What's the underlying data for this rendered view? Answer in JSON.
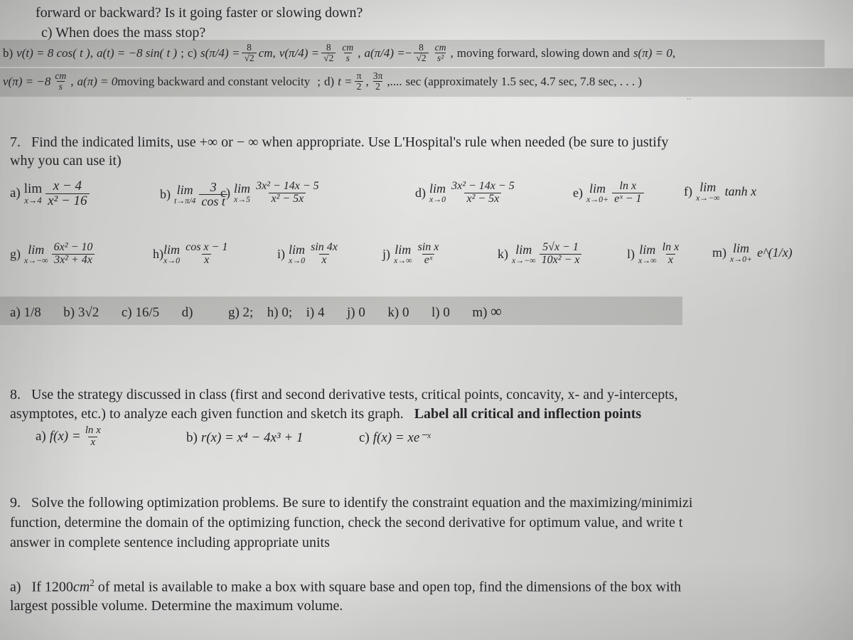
{
  "document": {
    "type": "calculus-worksheet-photo",
    "background_color": "#d2d2d0",
    "highlight_band_color": "#989896",
    "ink_color": "#26262a"
  },
  "top_fragment": {
    "line1": "forward or backward? Is it going faster or slowing down?",
    "line2": "c) When does the mass stop?",
    "answers_b": {
      "label": "b)",
      "v_of_t": "v(t) = 8 cos( t )",
      "a_of_t": "a(t) = −8 sin( t )",
      "sep1": ";",
      "label_c": "c)",
      "s_pi_4": "s(π/4) =",
      "s_value_num": "8",
      "s_value_den": "√2",
      "s_units": "cm",
      "v_pi_4": "v(π/4) =",
      "v_value_num": "8",
      "v_value_den": "√2",
      "v_units_num": "cm",
      "v_units_den": "s",
      "a_pi_4": "a(π/4) =",
      "a_sign": "−",
      "a_value_num": "8",
      "a_value_den": "√2",
      "a_units_num": "cm",
      "a_units_den": "s²",
      "conclusion1": "moving forward, slowing down  and",
      "s_pi": "s(π) = 0",
      "comma": ","
    },
    "answers_b2": {
      "v_pi": "v(π) = −8",
      "v_pi_units_num": "cm",
      "v_pi_units_den": "s",
      "a_pi": "a(π) = 0",
      "conclusion2": "moving backward and constant velocity",
      "sep2": ";",
      "label_d": "d)",
      "t_eq": "t =",
      "t_val1_num": "π",
      "t_val1_den": "2",
      "t_val2_num": "3π",
      "t_val2_den": "2",
      "t_ellipsis": ",....",
      "t_unit": "sec (approximately 1.5 sec, 4.7 sec, 7.8 sec, . . . )"
    }
  },
  "problem7": {
    "number": "7.",
    "prompt_line1": "Find the indicated limits, use +∞  or  − ∞ when appropriate. Use L'Hospital's rule when needed (be sure to justify",
    "prompt_line2": "why you can use it)",
    "row1": [
      {
        "label": "a)",
        "lim": "lim",
        "sub": "x→4",
        "num": "x − 4",
        "den": "x² − 16"
      },
      {
        "label": "b)",
        "lim": "lim",
        "sub": "t→π/4",
        "num": "3",
        "den": "cos t"
      },
      {
        "label": "c)",
        "lim": "lim",
        "sub": "x→5",
        "num": "3x² − 14x − 5",
        "den": "x² − 5x"
      },
      {
        "label": "d)",
        "lim": "lim",
        "sub": "x→0",
        "num": "3x² − 14x − 5",
        "den": "x² − 5x"
      },
      {
        "label": "e)",
        "lim": "lim",
        "sub": "x→0+",
        "num": "ln x",
        "den": "eˣ − 1"
      },
      {
        "label": "f)",
        "lim": "lim",
        "sub": "x→−∞",
        "expr": "tanh x"
      }
    ],
    "row2": [
      {
        "label": "g)",
        "lim": "lim",
        "sub": "x→−∞",
        "num": "6x² − 10",
        "den": "3x² + 4x"
      },
      {
        "label": "h)",
        "lim": "lim",
        "sub": "x→0",
        "num": "cos x − 1",
        "den": "x"
      },
      {
        "label": "i)",
        "lim": "lim",
        "sub": "x→0",
        "num": "sin 4x",
        "den": "x"
      },
      {
        "label": "j)",
        "lim": "lim",
        "sub": "x→∞",
        "num": "sin x",
        "den": "eˣ"
      },
      {
        "label": "k)",
        "lim": "lim",
        "sub": "x→−∞",
        "num": "5√x − 1",
        "den": "10x² − x"
      },
      {
        "label": "l)",
        "lim": "lim",
        "sub": "x→∞",
        "num": "ln x",
        "den": "x"
      },
      {
        "label": "m)",
        "lim": "lim",
        "sub": "x→0+",
        "expr": "e^(1/x)"
      }
    ],
    "answers": [
      {
        "label": "a)",
        "value": "1/8"
      },
      {
        "label": "b)",
        "value": "3√2"
      },
      {
        "label": "c)",
        "value": "16/5"
      },
      {
        "label": "d)",
        "value": ""
      },
      {
        "label": "g)",
        "value": "2;"
      },
      {
        "label": "h)",
        "value": "0;"
      },
      {
        "label": "i)",
        "value": "4"
      },
      {
        "label": "j)",
        "value": "0"
      },
      {
        "label": "k)",
        "value": "0"
      },
      {
        "label": "l)",
        "value": "0"
      },
      {
        "label": "m)",
        "value": "∞"
      }
    ]
  },
  "problem8": {
    "number": "8.",
    "prompt_normal_1": "Use the strategy discussed in class (first and second derivative tests, critical points, concavity, x- and y-intercepts,",
    "prompt_normal_2": "asymptotes, etc.) to analyze each given function and sketch its graph.",
    "prompt_bold": "Label all critical and inflection points",
    "items": [
      {
        "label": "a)",
        "fn": "f(x) =",
        "num": "ln x",
        "den": "x"
      },
      {
        "label": "b)",
        "fn": "r(x) = x⁴ − 4x³ + 1"
      },
      {
        "label": "c)",
        "fn": "f(x) = xe⁻ˣ"
      }
    ]
  },
  "problem9": {
    "number": "9.",
    "prompt_line1": "Solve the following optimization problems. Be sure to identify the constraint equation and the maximizing/minimizi",
    "prompt_line2": "function, determine the domain of the optimizing function, check the second derivative for optimum value, and write t",
    "prompt_line3": "answer in complete sentence including appropriate units",
    "items": [
      {
        "label": "a)",
        "text_part1": "If 1200",
        "text_units": "cm",
        "text_exp": "2",
        "text_part2": " of metal is available to make a box with square base and open top, find the dimensions of the box with",
        "text_line2": "largest possible volume. Determine the maximum volume."
      }
    ]
  }
}
